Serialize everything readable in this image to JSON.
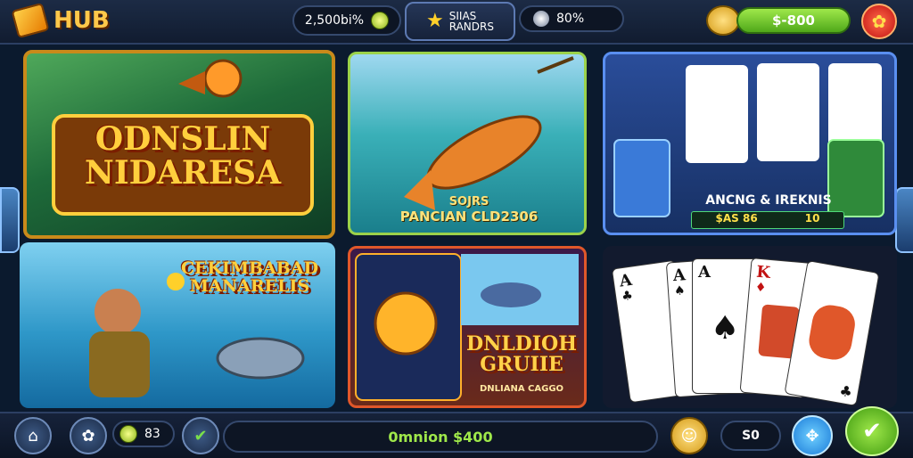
{
  "header": {
    "logo_text": "HUB",
    "coins": "2,500bi%",
    "badge_line1": "SIIAS",
    "badge_line2": "RANDRS",
    "gems": "80%",
    "wallet": "$-800"
  },
  "tiles": {
    "t1_title_line1": "ODNSLIN",
    "t1_title_line2": "NIDARESA",
    "t2_caption_line1": "SOJRS",
    "t2_caption_line2": "PANCIAN CLD2306",
    "t3_caption": "ANCNG & IREKNIS",
    "t3_stat1": "$AS 86",
    "t3_stat2": "10",
    "t4_title_line1": "CEKIMBABAD",
    "t4_title_line2": "MANARELIS",
    "t5_title_line1": "DNLDIOH",
    "t5_title_line2": "GRUIIE",
    "t5_subtitle": "DNLIANA CAGGO"
  },
  "cards": [
    "A",
    "A",
    "A",
    "K",
    ""
  ],
  "card_suits": [
    "♣",
    "♠",
    "♠",
    "♦",
    "♣"
  ],
  "footer": {
    "count": "83",
    "balance": "0mnion $400",
    "score": "S0"
  },
  "colors": {
    "accent_gold": "#ffc84a",
    "accent_green": "#6ccc2a",
    "accent_red": "#d42020"
  }
}
